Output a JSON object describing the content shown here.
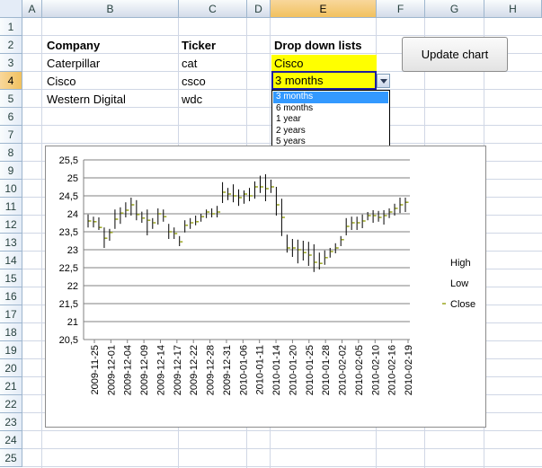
{
  "columns": [
    "A",
    "B",
    "C",
    "D",
    "E",
    "F",
    "G",
    "H"
  ],
  "rows": [
    "1",
    "2",
    "3",
    "4",
    "5",
    "6",
    "7",
    "8",
    "9",
    "10",
    "11",
    "12",
    "13",
    "14",
    "15",
    "16",
    "17",
    "18",
    "19",
    "20",
    "21",
    "22",
    "23",
    "24",
    "25"
  ],
  "headers": {
    "company": "Company",
    "ticker": "Ticker",
    "dropdown": "Drop down lists"
  },
  "companies": [
    {
      "name": "Caterpillar",
      "ticker": "cat"
    },
    {
      "name": "Cisco",
      "ticker": "csco"
    },
    {
      "name": "Western Digital",
      "ticker": "wdc"
    }
  ],
  "selected_company": "Cisco",
  "selected_period": "3 months",
  "dropdown_options": [
    "3 months",
    "6 months",
    "1 year",
    "2 years",
    "5 years"
  ],
  "update_button": "Update chart",
  "colors": {
    "yellow": "#ffff00",
    "selection": "#3399ff",
    "hl": "#000000",
    "close": "#9aa51f"
  },
  "chart_data": {
    "type": "stock-hlc",
    "y_ticks": [
      "25,5",
      "25",
      "24,5",
      "24",
      "23,5",
      "23",
      "22,5",
      "22",
      "21,5",
      "21",
      "20,5"
    ],
    "ylim": [
      20.5,
      25.5
    ],
    "x_tick_labels": [
      "2009-11-25",
      "2009-12-01",
      "2009-12-04",
      "2009-12-09",
      "2009-12-14",
      "2009-12-17",
      "2009-12-22",
      "2009-12-28",
      "2009-12-31",
      "2010-01-06",
      "2010-01-11",
      "2010-01-14",
      "2010-01-20",
      "2010-01-25",
      "2010-01-28",
      "2010-02-02",
      "2010-02-05",
      "2010-02-10",
      "2010-02-16",
      "2010-02-19"
    ],
    "legend": [
      "High",
      "Low",
      "Close"
    ],
    "high": [
      23.98,
      23.92,
      23.9,
      23.62,
      23.58,
      24.12,
      24.18,
      24.32,
      24.45,
      24.38,
      24.06,
      24.12,
      23.88,
      24.15,
      24.12,
      23.72,
      23.62,
      23.38,
      23.82,
      23.88,
      23.95,
      24.0,
      24.12,
      24.15,
      24.22,
      24.88,
      24.72,
      24.82,
      24.68,
      24.65,
      24.72,
      24.9,
      25.06,
      25.1,
      24.95,
      24.75,
      24.42,
      23.42,
      23.3,
      23.28,
      23.25,
      23.22,
      23.15,
      22.92,
      22.98,
      23.05,
      23.18,
      23.38,
      23.88,
      23.92,
      23.92,
      23.98,
      24.05,
      24.1,
      24.08,
      24.1,
      24.15,
      24.28,
      24.45,
      24.45
    ],
    "low": [
      23.62,
      23.62,
      23.55,
      23.05,
      23.25,
      23.58,
      23.72,
      23.9,
      23.95,
      23.82,
      23.75,
      23.4,
      23.58,
      23.7,
      23.78,
      23.3,
      23.3,
      23.1,
      23.48,
      23.58,
      23.68,
      23.78,
      23.88,
      23.9,
      23.9,
      24.3,
      24.38,
      24.32,
      24.22,
      24.28,
      24.35,
      24.42,
      24.58,
      24.35,
      24.58,
      23.95,
      23.38,
      22.92,
      22.8,
      22.62,
      22.7,
      22.55,
      22.38,
      22.45,
      22.58,
      22.78,
      22.9,
      23.1,
      23.4,
      23.55,
      23.55,
      23.6,
      23.82,
      23.75,
      23.78,
      23.7,
      23.88,
      23.95,
      24.02,
      24.05
    ],
    "close": [
      23.8,
      23.78,
      23.62,
      23.32,
      23.48,
      23.85,
      24.02,
      24.1,
      24.25,
      23.98,
      23.88,
      23.82,
      23.75,
      24.0,
      23.92,
      23.5,
      23.45,
      23.22,
      23.68,
      23.75,
      23.78,
      23.92,
      24.05,
      24.0,
      24.05,
      24.6,
      24.55,
      24.5,
      24.45,
      24.55,
      24.5,
      24.75,
      24.75,
      24.7,
      24.75,
      24.25,
      23.9,
      23.05,
      23.05,
      23.0,
      22.92,
      22.85,
      22.65,
      22.62,
      22.78,
      22.95,
      23.05,
      23.28,
      23.65,
      23.75,
      23.75,
      23.8,
      23.95,
      23.95,
      23.9,
      23.95,
      24.05,
      24.15,
      24.25,
      24.32
    ]
  }
}
